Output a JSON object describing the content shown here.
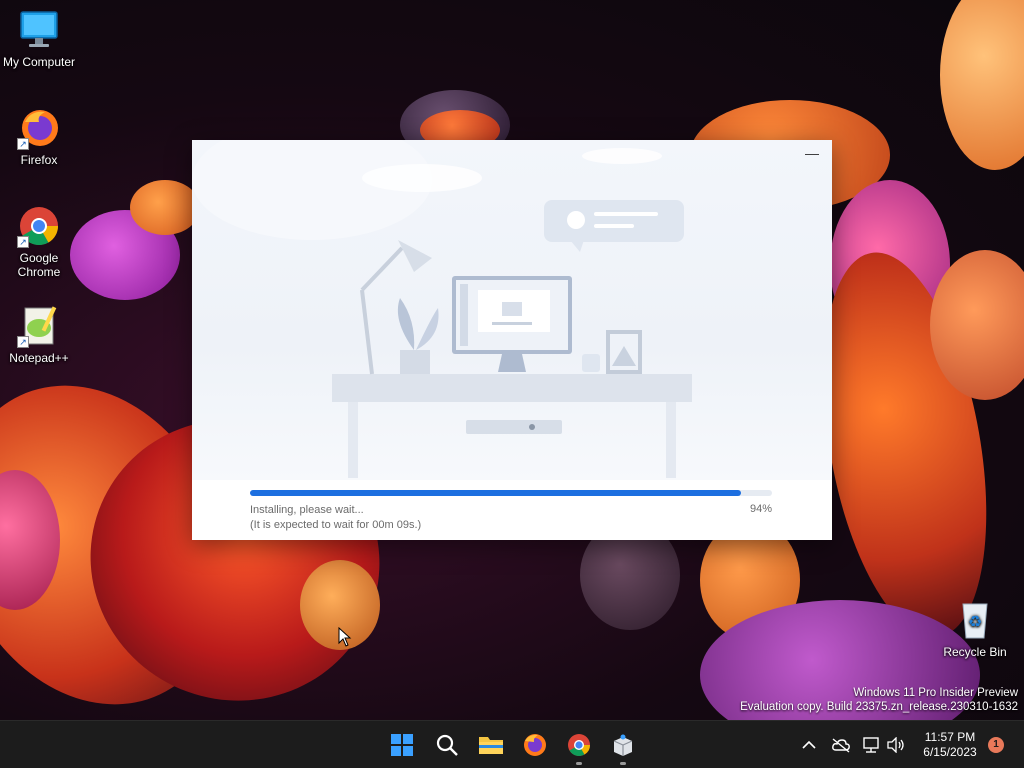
{
  "desktop": {
    "icons": [
      {
        "label": "My Computer",
        "icon": "monitor-icon"
      },
      {
        "label": "Firefox",
        "icon": "firefox-icon"
      },
      {
        "label": "Google Chrome",
        "icon": "chrome-icon"
      },
      {
        "label": "Notepad++",
        "icon": "notepadpp-icon"
      },
      {
        "label": "Recycle Bin",
        "icon": "recycle-bin-icon"
      }
    ]
  },
  "installer": {
    "minimize_label": "—",
    "status_line1": "Installing, please wait...",
    "status_line2": "(It is expected to wait for 00m 09s.)",
    "percent_label": "94%",
    "progress": 0.94,
    "accent": "#1d6fe0"
  },
  "watermark": {
    "line1": "Windows 11 Pro Insider Preview",
    "line2": "Evaluation copy. Build 23375.zn_release.230310-1632"
  },
  "taskbar": {
    "apps": [
      "start-icon",
      "search-icon",
      "file-explorer-icon",
      "firefox-icon",
      "chrome-icon",
      "installer-app-icon"
    ],
    "tray": {
      "time": "11:57 PM",
      "date": "6/15/2023",
      "notification_count": "1"
    }
  }
}
